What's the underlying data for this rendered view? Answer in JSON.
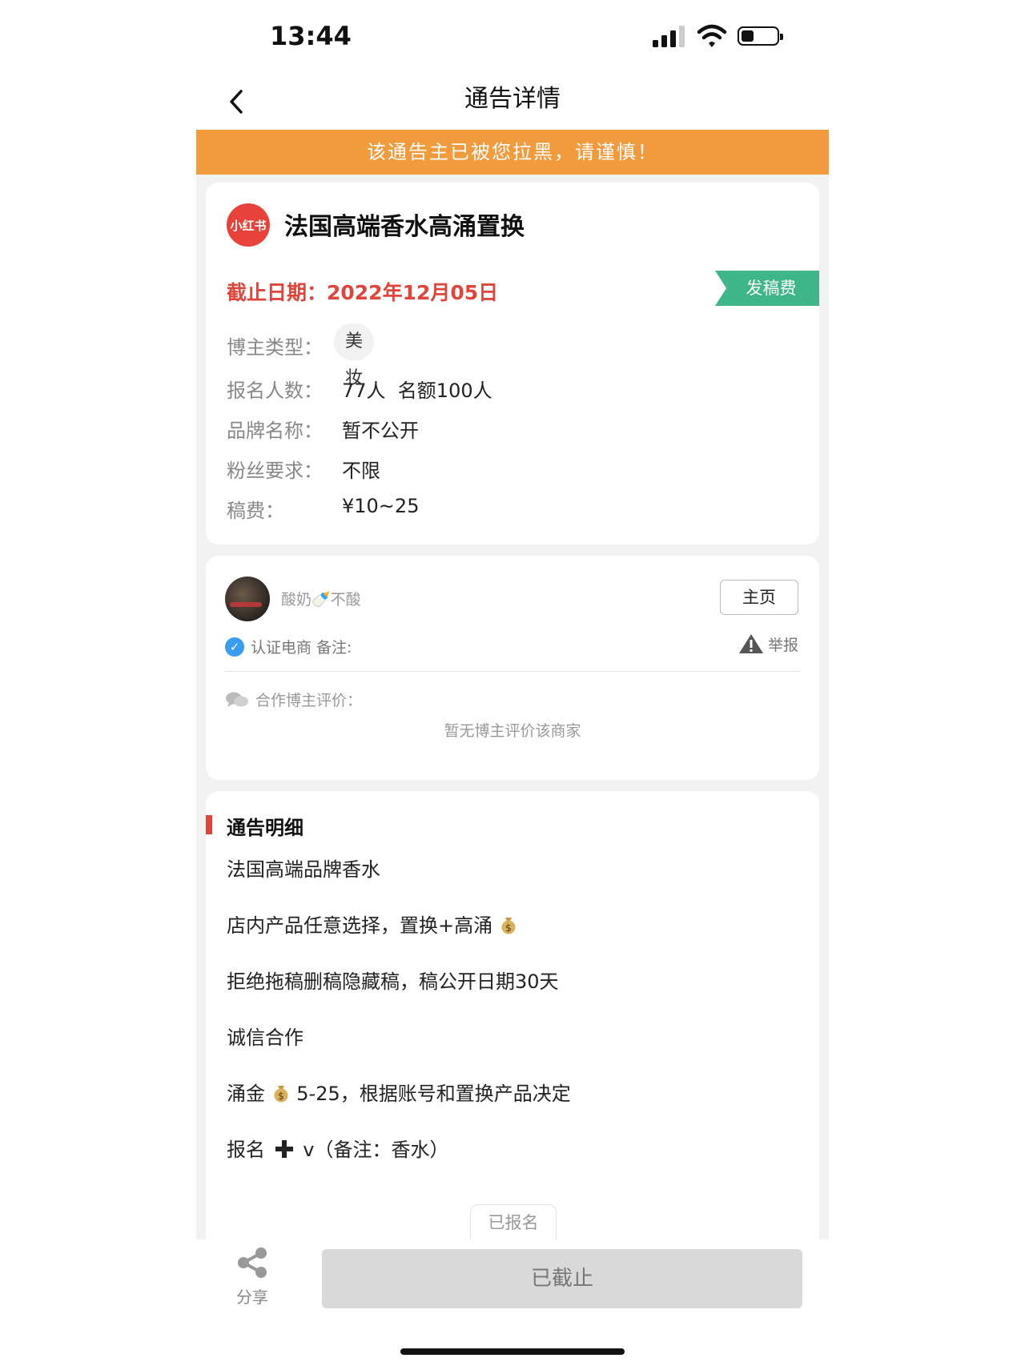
{
  "status": {
    "time": "13:44"
  },
  "nav": {
    "title": "通告详情"
  },
  "warning": "该通告主已被您拉黑，请谨慎！",
  "announcement": {
    "platform_logo": "小红书",
    "title": "法国高端香水高涌置换",
    "deadline": "截止日期：2022年12月05日",
    "ribbon": "发稿费",
    "fields": {
      "type_label": "博主类型：",
      "type_value": "美妆",
      "signup_label": "报名人数：",
      "signup_value": "77人  名额100人",
      "brand_label": "品牌名称：",
      "brand_value": "暂不公开",
      "fans_label": "粉丝要求：",
      "fans_value": "不限",
      "fee_label": "稿费：",
      "fee_value": "¥10~25"
    }
  },
  "merchant": {
    "name": "酸奶🍼不酸",
    "home_button": "主页",
    "verified": "认证电商  备注:",
    "report": "举报",
    "review_label": "合作博主评价：",
    "no_review": "暂无博主评价该商家"
  },
  "details": {
    "heading": "通告明细",
    "lines": [
      "法国高端品牌香水",
      "店内产品任意选择，置换+高涌",
      "拒绝拖稿删稿隐藏稿，稿公开日期30天",
      "诚信合作",
      "5-25，根据账号和置换产品决定",
      "v（备注：香水）"
    ],
    "line5_prefix": "涌金",
    "line6_prefix": "报名"
  },
  "bottom": {
    "signed_tab": "已报名",
    "share_label": "分享",
    "closed_button": "已截止"
  },
  "colors": {
    "warning_bg": "#f19b3d",
    "deadline": "#e0453b",
    "ribbon": "#3fb58a",
    "verify": "#3a9cf0"
  },
  "icons": [
    "back-chevron-icon",
    "signal-icon",
    "wifi-icon",
    "battery-icon",
    "verified-check-icon",
    "warning-triangle-icon",
    "chat-bubbles-icon",
    "money-bag-icon",
    "plus-icon",
    "share-icon"
  ]
}
